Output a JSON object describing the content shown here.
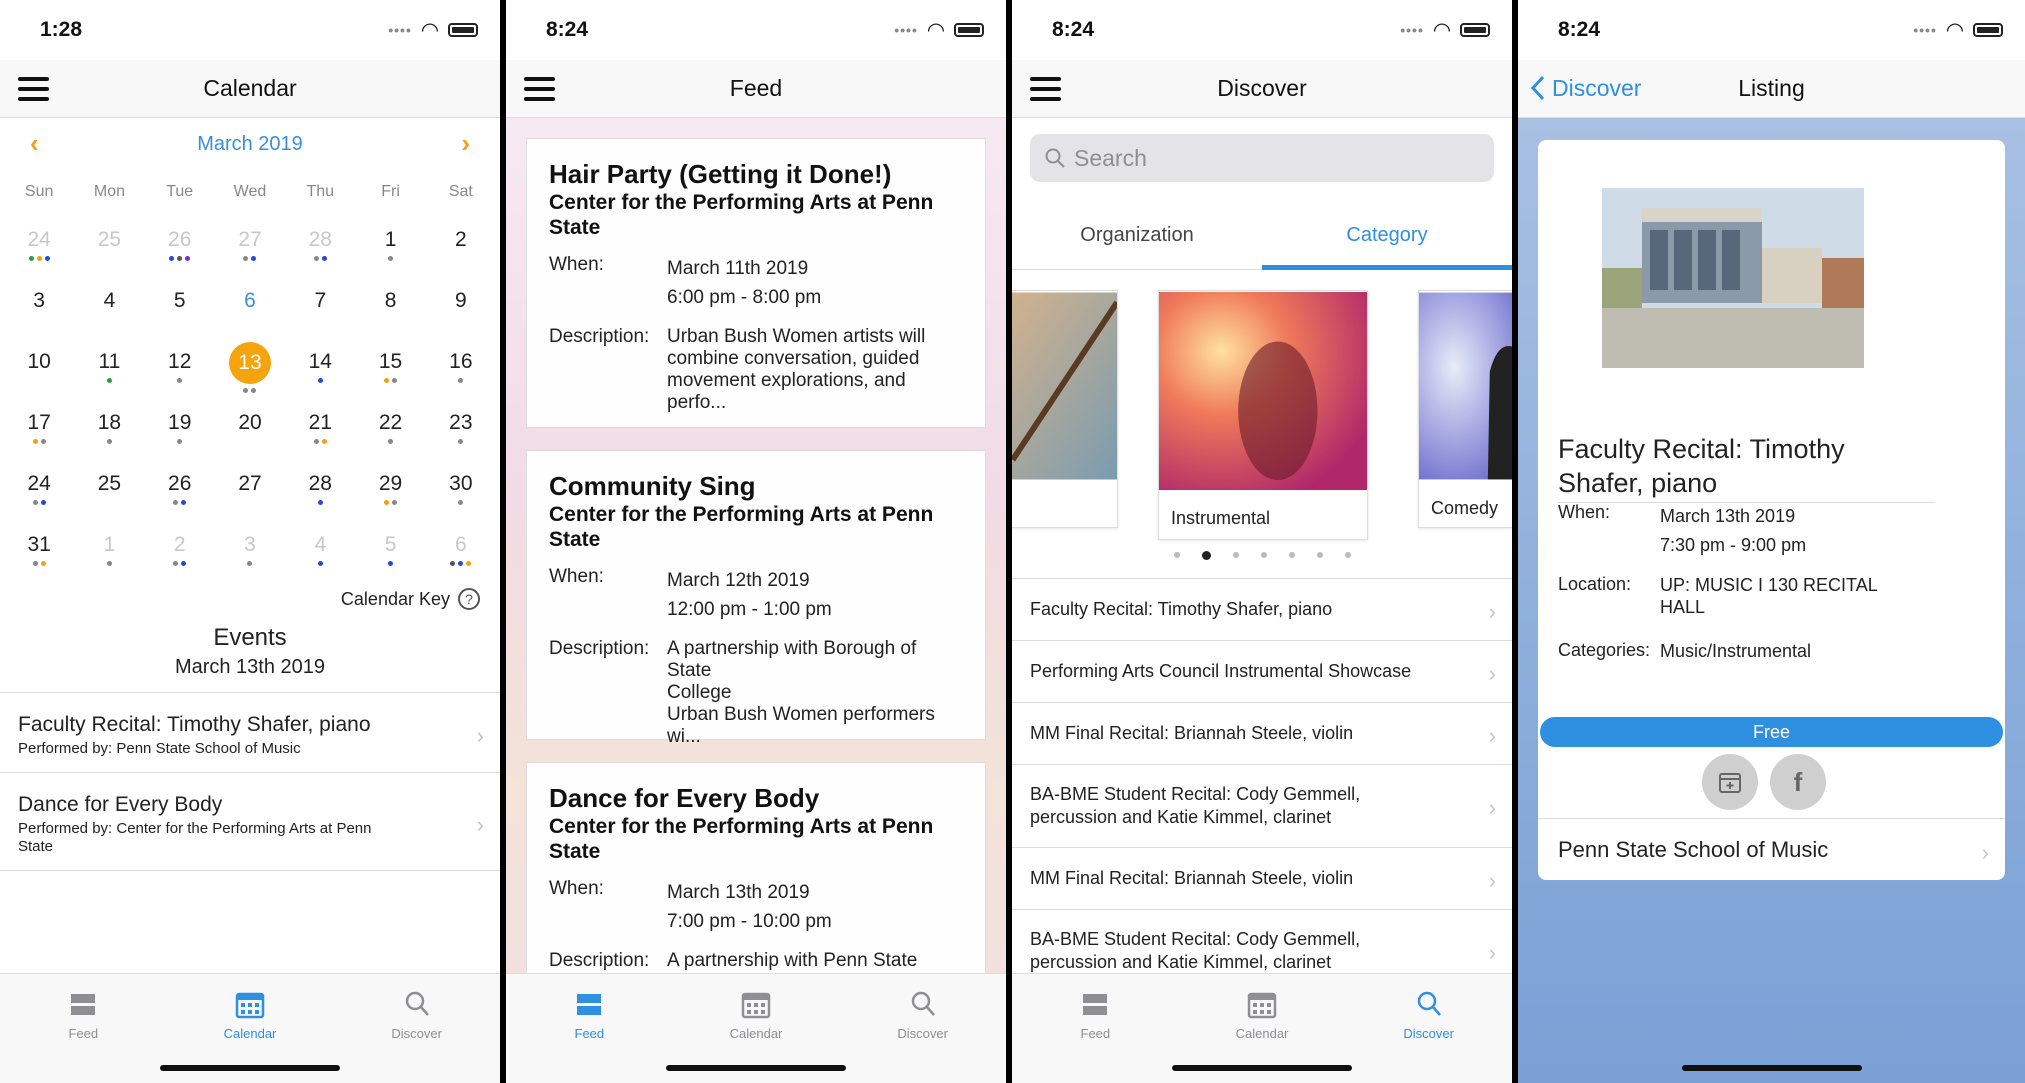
{
  "screens": {
    "calendar": {
      "time": "1:28",
      "title": "Calendar",
      "month": "March 2019",
      "weekdays": [
        "Sun",
        "Mon",
        "Tue",
        "Wed",
        "Thu",
        "Fri",
        "Sat"
      ],
      "calendar_key": "Calendar Key",
      "events_title": "Events",
      "events_date": "March 13th 2019",
      "events": [
        {
          "title": "Faculty Recital: Timothy Shafer, piano",
          "sub": "Performed by: Penn State School of Music"
        },
        {
          "title": "Dance for Every Body",
          "sub": "Performed by: Center for the Performing Arts at Penn\nState"
        }
      ],
      "days": [
        {
          "n": "24",
          "mute": true,
          "dots": [
            "#2a9d4a",
            "#f4a010",
            "#2a47d8"
          ]
        },
        {
          "n": "25",
          "mute": true,
          "dots": []
        },
        {
          "n": "26",
          "mute": true,
          "dots": [
            "#2a47d8",
            "#555",
            "#7a2ad8"
          ]
        },
        {
          "n": "27",
          "mute": true,
          "dots": [
            "#888",
            "#2a47d8"
          ]
        },
        {
          "n": "28",
          "mute": true,
          "dots": [
            "#888",
            "#2a47d8"
          ]
        },
        {
          "n": "1",
          "dots": [
            "#888"
          ]
        },
        {
          "n": "2",
          "dots": []
        },
        {
          "n": "3",
          "dots": []
        },
        {
          "n": "4",
          "dots": []
        },
        {
          "n": "5",
          "dots": []
        },
        {
          "n": "6",
          "blue": true,
          "dots": []
        },
        {
          "n": "7",
          "dots": []
        },
        {
          "n": "8",
          "dots": []
        },
        {
          "n": "9",
          "dots": []
        },
        {
          "n": "10",
          "dots": []
        },
        {
          "n": "11",
          "dots": [
            "#2a9d4a"
          ]
        },
        {
          "n": "12",
          "dots": [
            "#888"
          ]
        },
        {
          "n": "13",
          "sel": true,
          "dots": [
            "#888",
            "#888"
          ]
        },
        {
          "n": "14",
          "dots": [
            "#2a47d8"
          ]
        },
        {
          "n": "15",
          "dots": [
            "#f4a010",
            "#888"
          ]
        },
        {
          "n": "16",
          "dots": [
            "#888"
          ]
        },
        {
          "n": "17",
          "dots": [
            "#f4a010",
            "#888"
          ]
        },
        {
          "n": "18",
          "dots": [
            "#888"
          ]
        },
        {
          "n": "19",
          "dots": [
            "#888"
          ]
        },
        {
          "n": "20",
          "dots": []
        },
        {
          "n": "21",
          "dots": [
            "#888",
            "#f4a010"
          ]
        },
        {
          "n": "22",
          "dots": [
            "#888"
          ]
        },
        {
          "n": "23",
          "dots": [
            "#888"
          ]
        },
        {
          "n": "24",
          "dots": [
            "#888",
            "#2a47d8"
          ]
        },
        {
          "n": "25",
          "dots": []
        },
        {
          "n": "26",
          "dots": [
            "#888",
            "#2a47d8"
          ]
        },
        {
          "n": "27",
          "dots": []
        },
        {
          "n": "28",
          "dots": [
            "#2a47d8"
          ]
        },
        {
          "n": "29",
          "dots": [
            "#f4a010",
            "#888"
          ]
        },
        {
          "n": "30",
          "dots": [
            "#888"
          ]
        },
        {
          "n": "31",
          "dots": [
            "#888",
            "#f4a010"
          ]
        },
        {
          "n": "1",
          "mute": true,
          "dots": [
            "#888"
          ]
        },
        {
          "n": "2",
          "mute": true,
          "dots": [
            "#888",
            "#2a47d8"
          ]
        },
        {
          "n": "3",
          "mute": true,
          "dots": [
            "#888"
          ]
        },
        {
          "n": "4",
          "mute": true,
          "dots": [
            "#2a47d8"
          ]
        },
        {
          "n": "5",
          "mute": true,
          "dots": [
            "#2a47d8"
          ]
        },
        {
          "n": "6",
          "mute": true,
          "dots": [
            "#555",
            "#2a47d8",
            "#f4a010"
          ]
        }
      ]
    },
    "feed": {
      "time": "8:24",
      "title": "Feed",
      "cards": [
        {
          "title": "Hair Party (Getting it Done!)",
          "org": "Center for the Performing Arts at Penn\nState",
          "when_label": "When:",
          "when": "March 11th 2019\n6:00 pm - 8:00 pm",
          "desc_label": "Description:",
          "desc": "Urban Bush Women artists will\ncombine conversation, guided\nmovement explorations, and perfo..."
        },
        {
          "title": "Community Sing",
          "org": "Center for the Performing Arts at Penn\nState",
          "when_label": "When:",
          "when": "March 12th 2019\n12:00 pm - 1:00 pm",
          "desc_label": "Description:",
          "desc": "A partnership with Borough of State\nCollege\nUrban Bush Women performers wi..."
        },
        {
          "title": "Dance for Every Body",
          "org": "Center for the Performing Arts at Penn\nState",
          "when_label": "When:",
          "when": "March 13th 2019\n7:00 pm - 10:00 pm",
          "desc_label": "Description:",
          "desc": "A partnership with Penn State"
        }
      ]
    },
    "discover": {
      "time": "8:24",
      "title": "Discover",
      "search_placeholder": "Search",
      "segments": [
        "Organization",
        "Category"
      ],
      "carousel": [
        "Instrumental",
        "Comedy"
      ],
      "list": [
        "Faculty Recital: Timothy Shafer, piano",
        "Performing Arts Council Instrumental Showcase",
        "MM Final Recital: Briannah Steele, violin",
        "BA-BME Student Recital: Cody Gemmell,\npercussion and Katie Kimmel, clarinet",
        "MM Final Recital: Briannah Steele, violin",
        "BA-BME Student Recital: Cody Gemmell,\npercussion and Katie Kimmel, clarinet"
      ]
    },
    "listing": {
      "time": "8:24",
      "back": "Discover",
      "title": "Listing",
      "event_title": "Faculty Recital: Timothy\nShafer, piano",
      "when_label": "When:",
      "when": "March 13th 2019\n7:30 pm - 9:00 pm",
      "location_label": "Location:",
      "location": "UP: MUSIC I 130 RECITAL\nHALL",
      "categories_label": "Categories:",
      "categories": "Music/Instrumental",
      "price": "Free",
      "org": "Penn State School of Music"
    }
  },
  "tabs": [
    "Feed",
    "Calendar",
    "Discover"
  ],
  "colors": {
    "accent": "#2f8fe0",
    "selected_day": "#f5a30f",
    "nav_arrow": "#f4a010"
  }
}
